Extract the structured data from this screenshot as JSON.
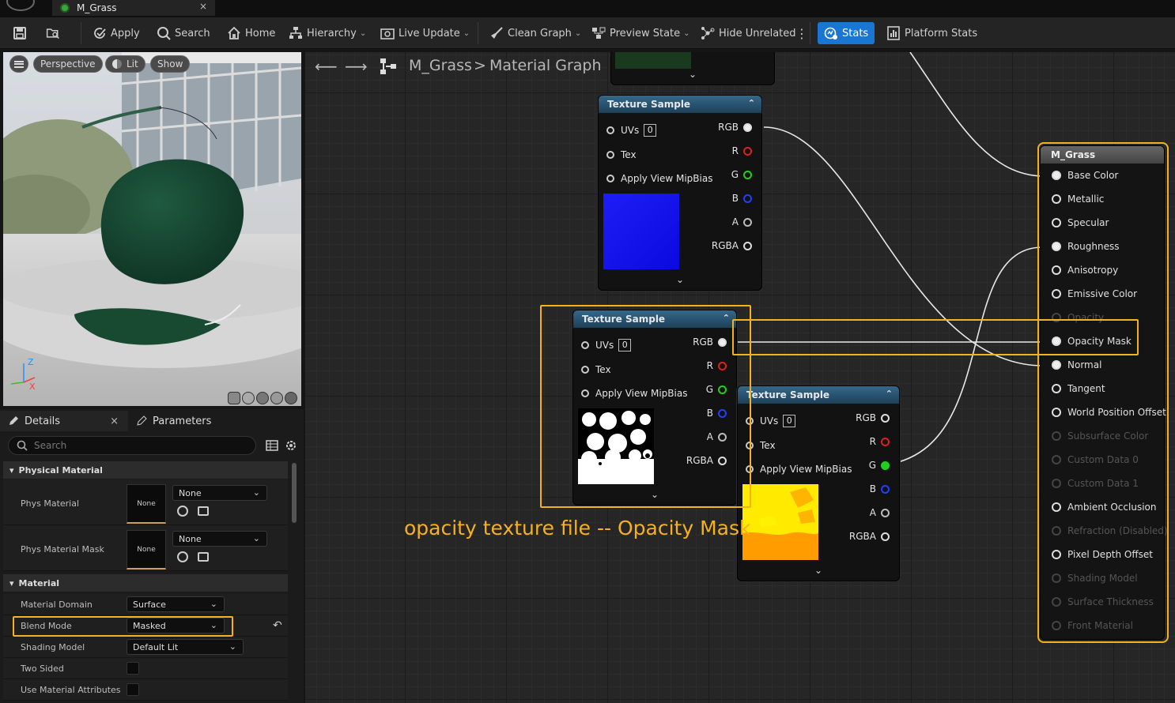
{
  "tab": {
    "title": "M_Grass",
    "close": "×"
  },
  "toolbar": {
    "apply": "Apply",
    "search": "Search",
    "home": "Home",
    "hierarchy": "Hierarchy",
    "live_update": "Live Update",
    "clean_graph": "Clean Graph",
    "preview_state": "Preview State",
    "hide_unrelated": "Hide Unrelated",
    "stats": "Stats",
    "platform_stats": "Platform Stats",
    "dropdown": "⌄",
    "more": "⋮"
  },
  "viewport": {
    "perspective": "Perspective",
    "lit": "Lit",
    "show": "Show",
    "axis_z": "Z",
    "axis_x": "X"
  },
  "details": {
    "tab_details": "Details",
    "tab_parameters": "Parameters",
    "close": "×",
    "search_placeholder": "Search",
    "cat_physical": "Physical Material",
    "cat_material": "Material",
    "phys_material": {
      "label": "Phys Material",
      "thumb": "None",
      "value": "None"
    },
    "phys_material_mask": {
      "label": "Phys Material Mask",
      "thumb": "None",
      "value": "None"
    },
    "material_domain": {
      "label": "Material Domain",
      "value": "Surface"
    },
    "blend_mode": {
      "label": "Blend Mode",
      "value": "Masked"
    },
    "shading_model": {
      "label": "Shading Model",
      "value": "Default Lit"
    },
    "two_sided": {
      "label": "Two Sided"
    },
    "use_material_attributes": {
      "label": "Use Material Attributes"
    },
    "reset": "↶"
  },
  "graph": {
    "breadcrumb_asset": "M_Grass",
    "breadcrumb_sep": ">",
    "breadcrumb_graph": "Material Graph",
    "annotation": "opacity texture file -- Opacity Mask",
    "expand": "⌄",
    "collapse": "⌃",
    "nodes": [
      {
        "title": "Texture Sample",
        "uvs_label": "UVs",
        "uvs_value": "0",
        "tex": "Tex",
        "mip": "Apply View MipBias",
        "outputs": [
          "RGB",
          "R",
          "G",
          "B",
          "A",
          "RGBA"
        ]
      },
      {
        "title": "Texture Sample",
        "uvs_label": "UVs",
        "uvs_value": "0",
        "tex": "Tex",
        "mip": "Apply View MipBias",
        "outputs": [
          "RGB",
          "R",
          "G",
          "B",
          "A",
          "RGBA"
        ]
      },
      {
        "title": "Texture Sample",
        "uvs_label": "UVs",
        "uvs_value": "0",
        "tex": "Tex",
        "mip": "Apply View MipBias",
        "outputs": [
          "RGB",
          "R",
          "G",
          "B",
          "A",
          "RGBA"
        ]
      }
    ],
    "result_node": {
      "title": "M_Grass",
      "pins": [
        {
          "label": "Base Color",
          "enabled": true
        },
        {
          "label": "Metallic",
          "enabled": true
        },
        {
          "label": "Specular",
          "enabled": true
        },
        {
          "label": "Roughness",
          "enabled": true
        },
        {
          "label": "Anisotropy",
          "enabled": true
        },
        {
          "label": "Emissive Color",
          "enabled": true
        },
        {
          "label": "Opacity",
          "enabled": false
        },
        {
          "label": "Opacity Mask",
          "enabled": true
        },
        {
          "label": "Normal",
          "enabled": true
        },
        {
          "label": "Tangent",
          "enabled": true
        },
        {
          "label": "World Position Offset",
          "enabled": true
        },
        {
          "label": "Subsurface Color",
          "enabled": false
        },
        {
          "label": "Custom Data 0",
          "enabled": false
        },
        {
          "label": "Custom Data 1",
          "enabled": false
        },
        {
          "label": "Ambient Occlusion",
          "enabled": true
        },
        {
          "label": "Refraction (Disabled)",
          "enabled": false
        },
        {
          "label": "Pixel Depth Offset",
          "enabled": true
        },
        {
          "label": "Shading Model",
          "enabled": false
        },
        {
          "label": "Surface Thickness",
          "enabled": false
        },
        {
          "label": "Front Material",
          "enabled": false
        }
      ]
    }
  },
  "colors": {
    "accent": "#f5b21c",
    "stats_bg": "#1976d2",
    "node_header": "#2a5574"
  }
}
